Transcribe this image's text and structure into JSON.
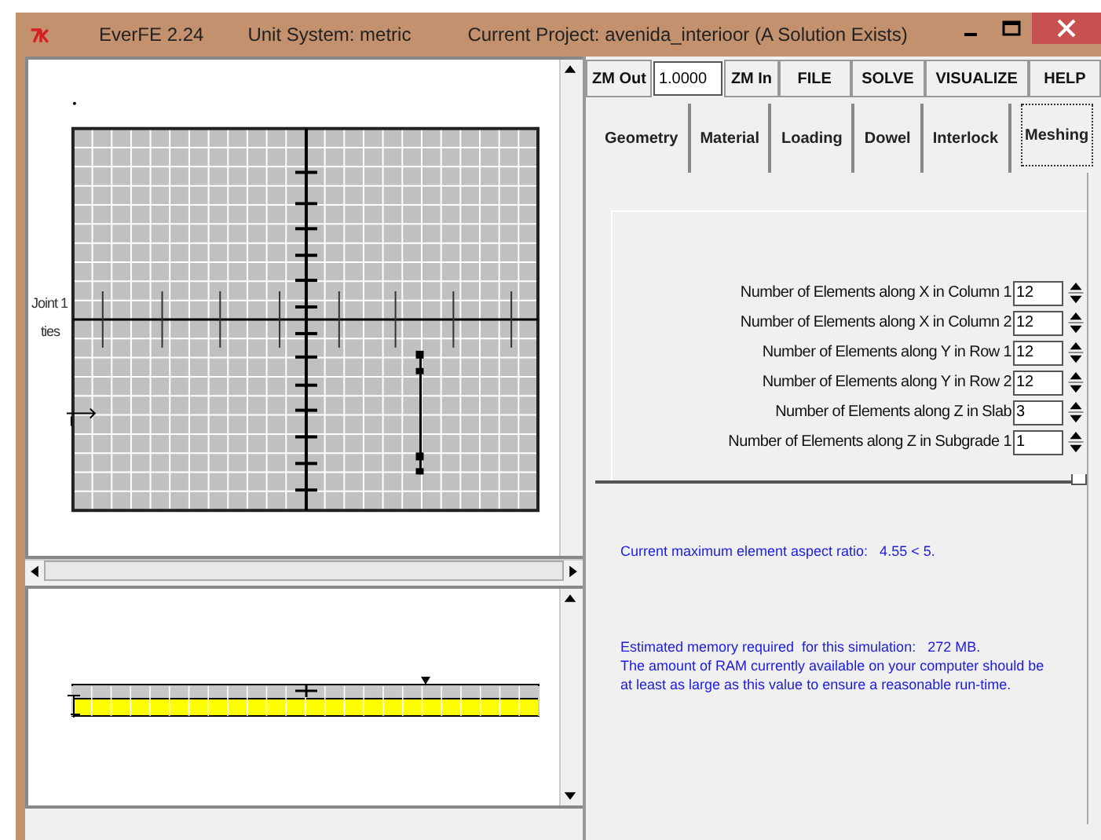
{
  "window": {
    "app": "EverFE 2.24",
    "units": "Unit System: metric",
    "project": "Current Project: avenida_interioor (A Solution Exists)"
  },
  "toolbar": {
    "zoom_out": "ZM Out",
    "zoom_value": "1.0000",
    "zoom_in": "ZM In",
    "menus": [
      "FILE",
      "SOLVE",
      "VISUALIZE",
      "HELP"
    ]
  },
  "plan_view": {
    "labels": [
      "Joint 1",
      "ties"
    ]
  },
  "tabs": [
    {
      "label": "Geometry",
      "selected": false
    },
    {
      "label": "Material",
      "selected": false
    },
    {
      "label": "Loading",
      "selected": false
    },
    {
      "label": "Dowel",
      "selected": false
    },
    {
      "label": "Interlock",
      "selected": false
    },
    {
      "label": "Meshing",
      "selected": true
    }
  ],
  "meshing": {
    "fields": [
      {
        "label": "Number of Elements along X in Column 1",
        "value": "12"
      },
      {
        "label": "Number of Elements along X in Column 2",
        "value": "12"
      },
      {
        "label": "Number of Elements along Y in Row 1",
        "value": "12"
      },
      {
        "label": "Number of Elements along Y in Row 2",
        "value": "12"
      },
      {
        "label": "Number of Elements along Z in Slab",
        "value": "3"
      },
      {
        "label": "Number of Elements along Z in Subgrade 1",
        "value": "1"
      }
    ],
    "aspect_ratio": "Current maximum element aspect ratio:   4.55 < 5.",
    "memory_lines": [
      "Estimated memory required  for this simulation:   272 MB.",
      "The amount of RAM currently available on your computer should be",
      "at least as large as this value to ensure a reasonable run-time."
    ]
  }
}
